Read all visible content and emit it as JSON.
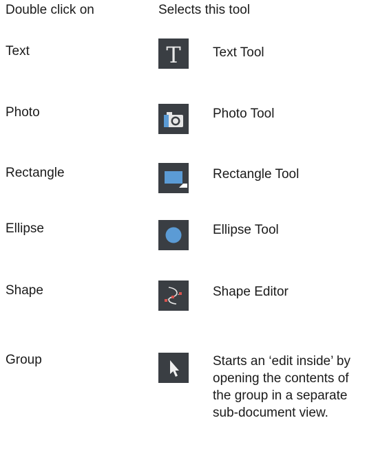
{
  "header": {
    "col1": "Double click on",
    "col2": "Selects this tool"
  },
  "rows": [
    {
      "trigger": "Text",
      "icon": "text-tool-icon",
      "desc": "Text Tool"
    },
    {
      "trigger": "Photo",
      "icon": "photo-tool-icon",
      "desc": "Photo Tool"
    },
    {
      "trigger": "Rectangle",
      "icon": "rectangle-tool-icon",
      "desc": "Rectangle Tool"
    },
    {
      "trigger": "Ellipse",
      "icon": "ellipse-tool-icon",
      "desc": "Ellipse Tool"
    },
    {
      "trigger": "Shape",
      "icon": "shape-editor-icon",
      "desc": "Shape Editor"
    },
    {
      "trigger": "Group",
      "icon": "selector-arrow-icon",
      "desc": "Starts an ‘edit inside’ by opening the contents of the group in a separate sub-document view."
    }
  ],
  "colors": {
    "icon_bg": "#3a3e43",
    "accent_blue": "#5b9bd5"
  }
}
